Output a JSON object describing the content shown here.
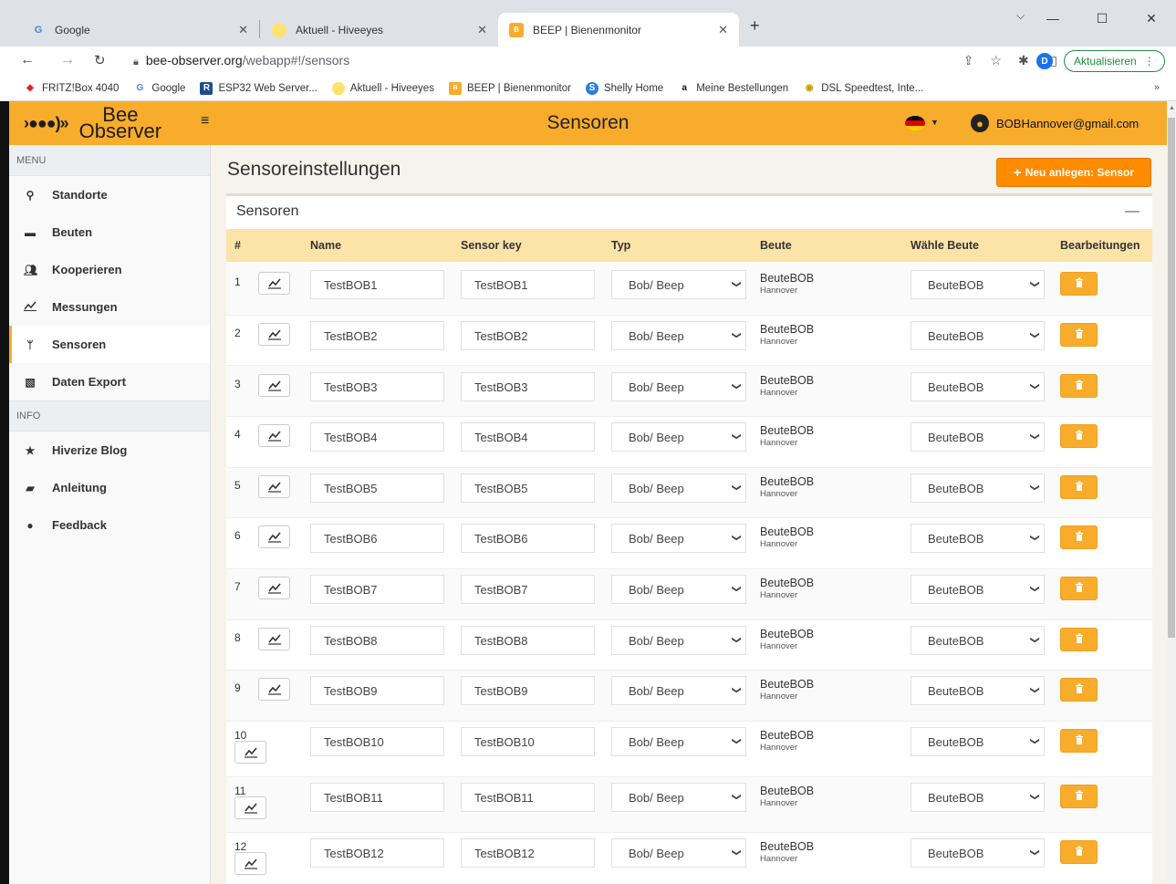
{
  "browser": {
    "tabs": [
      {
        "title": "Google",
        "icon": "google-icon"
      },
      {
        "title": "Aktuell - Hiveeyes",
        "icon": "hiveeyes-icon"
      },
      {
        "title": "BEEP | Bienenmonitor",
        "icon": "beep-icon"
      }
    ],
    "url_host": "bee-observer.org",
    "url_path": "/webapp#!/sensors",
    "profile_initial": "D",
    "update_label": "Aktualisieren",
    "bookmarks": [
      {
        "label": "FRITZ!Box 4040",
        "icon": "fritz-icon"
      },
      {
        "label": "Google",
        "icon": "google-icon"
      },
      {
        "label": "ESP32 Web Server...",
        "icon": "r-icon"
      },
      {
        "label": "Aktuell - Hiveeyes",
        "icon": "hiveeyes-icon"
      },
      {
        "label": "BEEP | Bienenmonitor",
        "icon": "beep-icon"
      },
      {
        "label": "Shelly Home",
        "icon": "shelly-icon"
      },
      {
        "label": "Meine Bestellungen",
        "icon": "amazon-icon"
      },
      {
        "label": "DSL Speedtest, Inte...",
        "icon": "speedtest-icon"
      }
    ]
  },
  "header": {
    "logo_line1": "Bee",
    "logo_line2": "Observer",
    "title": "Sensoren",
    "user_email": "BOBHannover@gmail.com"
  },
  "sidebar": {
    "menu_heading": "MENU",
    "menu_items": [
      {
        "label": "Standorte",
        "icon": "location-pin-icon"
      },
      {
        "label": "Beuten",
        "icon": "beehive-icon"
      },
      {
        "label": "Kooperieren",
        "icon": "users-icon"
      },
      {
        "label": "Messungen",
        "icon": "line-chart-icon"
      },
      {
        "label": "Sensoren",
        "icon": "rss-icon"
      },
      {
        "label": "Daten Export",
        "icon": "excel-file-icon"
      }
    ],
    "info_heading": "INFO",
    "info_items": [
      {
        "label": "Hiverize Blog",
        "icon": "star-icon"
      },
      {
        "label": "Anleitung",
        "icon": "book-icon"
      },
      {
        "label": "Feedback",
        "icon": "comment-icon"
      }
    ]
  },
  "main": {
    "title": "Sensoreinstellungen",
    "new_button": "Neu anlegen: Sensor",
    "panel_title": "Sensoren",
    "columns": [
      "#",
      "Name",
      "Sensor key",
      "Typ",
      "Beute",
      "Wähle Beute",
      "Bearbeitungen"
    ],
    "rows": [
      {
        "num": "1",
        "name": "TestBOB1",
        "key": "TestBOB1",
        "type": "Bob/ Beep",
        "beute": "BeuteBOB",
        "location": "Hannover",
        "choice": "BeuteBOB"
      },
      {
        "num": "2",
        "name": "TestBOB2",
        "key": "TestBOB2",
        "type": "Bob/ Beep",
        "beute": "BeuteBOB",
        "location": "Hannover",
        "choice": "BeuteBOB"
      },
      {
        "num": "3",
        "name": "TestBOB3",
        "key": "TestBOB3",
        "type": "Bob/ Beep",
        "beute": "BeuteBOB",
        "location": "Hannover",
        "choice": "BeuteBOB"
      },
      {
        "num": "4",
        "name": "TestBOB4",
        "key": "TestBOB4",
        "type": "Bob/ Beep",
        "beute": "BeuteBOB",
        "location": "Hannover",
        "choice": "BeuteBOB"
      },
      {
        "num": "5",
        "name": "TestBOB5",
        "key": "TestBOB5",
        "type": "Bob/ Beep",
        "beute": "BeuteBOB",
        "location": "Hannover",
        "choice": "BeuteBOB"
      },
      {
        "num": "6",
        "name": "TestBOB6",
        "key": "TestBOB6",
        "type": "Bob/ Beep",
        "beute": "BeuteBOB",
        "location": "Hannover",
        "choice": "BeuteBOB"
      },
      {
        "num": "7",
        "name": "TestBOB7",
        "key": "TestBOB7",
        "type": "Bob/ Beep",
        "beute": "BeuteBOB",
        "location": "Hannover",
        "choice": "BeuteBOB"
      },
      {
        "num": "8",
        "name": "TestBOB8",
        "key": "TestBOB8",
        "type": "Bob/ Beep",
        "beute": "BeuteBOB",
        "location": "Hannover",
        "choice": "BeuteBOB"
      },
      {
        "num": "9",
        "name": "TestBOB9",
        "key": "TestBOB9",
        "type": "Bob/ Beep",
        "beute": "BeuteBOB",
        "location": "Hannover",
        "choice": "BeuteBOB"
      },
      {
        "num": "10",
        "name": "TestBOB10",
        "key": "TestBOB10",
        "type": "Bob/ Beep",
        "beute": "BeuteBOB",
        "location": "Hannover",
        "choice": "BeuteBOB"
      },
      {
        "num": "11",
        "name": "TestBOB11",
        "key": "TestBOB11",
        "type": "Bob/ Beep",
        "beute": "BeuteBOB",
        "location": "Hannover",
        "choice": "BeuteBOB"
      },
      {
        "num": "12",
        "name": "TestBOB12",
        "key": "TestBOB12",
        "type": "Bob/ Beep",
        "beute": "BeuteBOB",
        "location": "Hannover",
        "choice": "BeuteBOB"
      }
    ]
  },
  "colors": {
    "accent": "#f7ac2c",
    "button_orange": "#ff8b00",
    "table_header": "#fce3a8"
  }
}
